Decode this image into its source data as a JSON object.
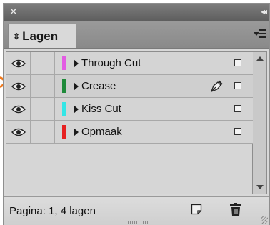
{
  "panel": {
    "close_icon": "close-icon",
    "collapse_icon": "collapse-double-chevron-icon",
    "tab_label": "Lagen",
    "tab_icon": "updown-arrows-icon",
    "menu_icon": "panel-menu-icon"
  },
  "layers": [
    {
      "name": "Through Cut",
      "color": "#e35ce3",
      "visible": true,
      "targeted": false,
      "active": false
    },
    {
      "name": "Crease",
      "color": "#1f8a3a",
      "visible": true,
      "targeted": false,
      "active": true
    },
    {
      "name": "Kiss Cut",
      "color": "#33e6e6",
      "visible": true,
      "targeted": false,
      "active": false
    },
    {
      "name": "Opmaak",
      "color": "#e62020",
      "visible": true,
      "targeted": false,
      "active": false
    }
  ],
  "footer": {
    "status": "Pagina: 1, 4 lagen",
    "new_layer_icon": "new-layer-icon",
    "delete_icon": "trash-icon"
  },
  "colors": {
    "pointer_arrow": "#f07a1e"
  }
}
